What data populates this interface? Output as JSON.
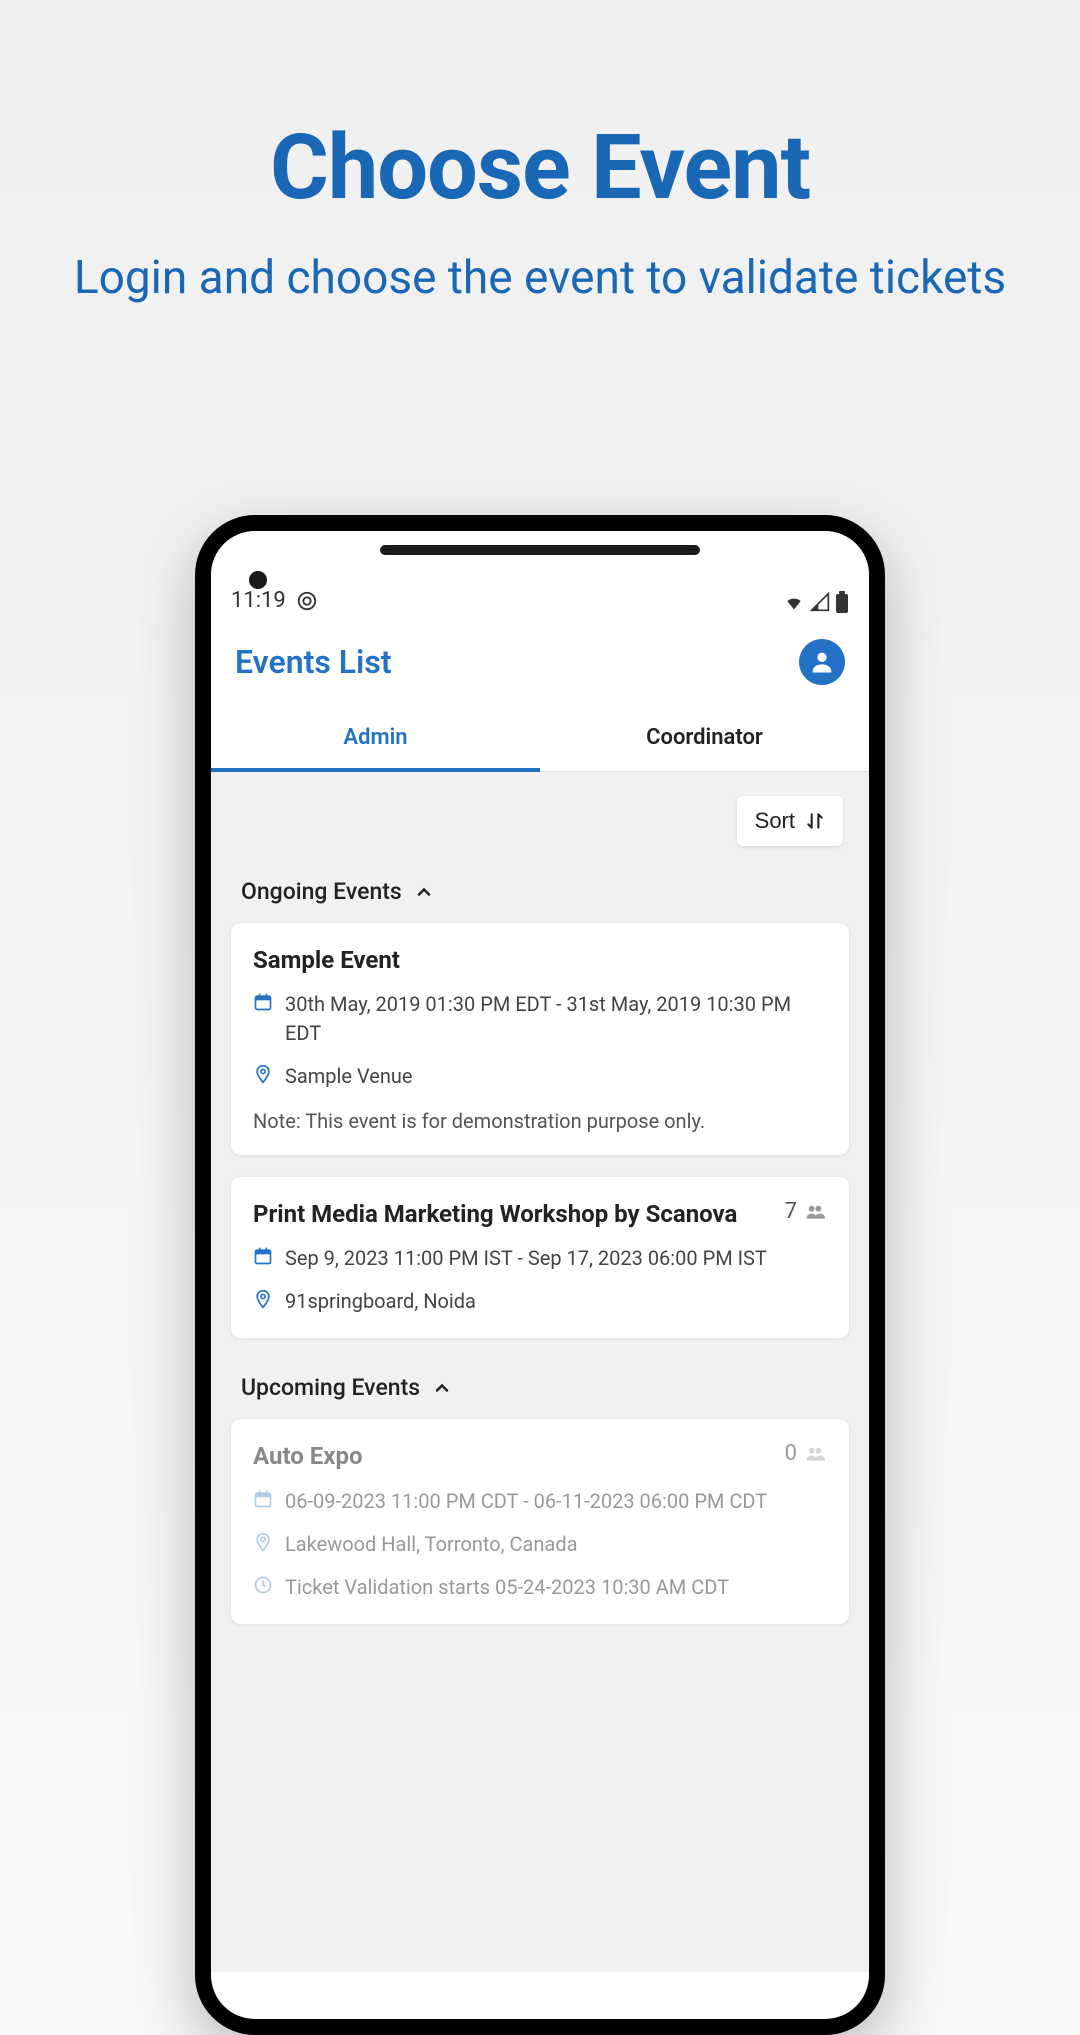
{
  "promo": {
    "title": "Choose Event",
    "subtitle": "Login and choose the event to validate tickets"
  },
  "status": {
    "time": "11:19"
  },
  "header": {
    "title": "Events List"
  },
  "tabs": {
    "admin": "Admin",
    "coordinator": "Coordinator"
  },
  "sort_label": "Sort",
  "sections": {
    "ongoing": "Ongoing Events",
    "upcoming": "Upcoming Events"
  },
  "events": {
    "sample": {
      "title": "Sample Event",
      "date": "30th May, 2019 01:30 PM EDT - 31st May, 2019 10:30 PM EDT",
      "venue": "Sample Venue",
      "note": "Note: This event is for demonstration purpose only."
    },
    "workshop": {
      "title": "Print Media Marketing Workshop by Scanova",
      "attendees": "7",
      "date": "Sep 9, 2023 11:00 PM IST - Sep 17, 2023 06:00 PM IST",
      "venue": "91springboard, Noida"
    },
    "autoexpo": {
      "title": "Auto Expo",
      "attendees": "0",
      "date": "06-09-2023 11:00 PM CDT - 06-11-2023 06:00 PM CDT",
      "venue": "Lakewood Hall, Torronto, Canada",
      "validation": "Ticket Validation starts 05-24-2023 10:30 AM CDT"
    }
  }
}
